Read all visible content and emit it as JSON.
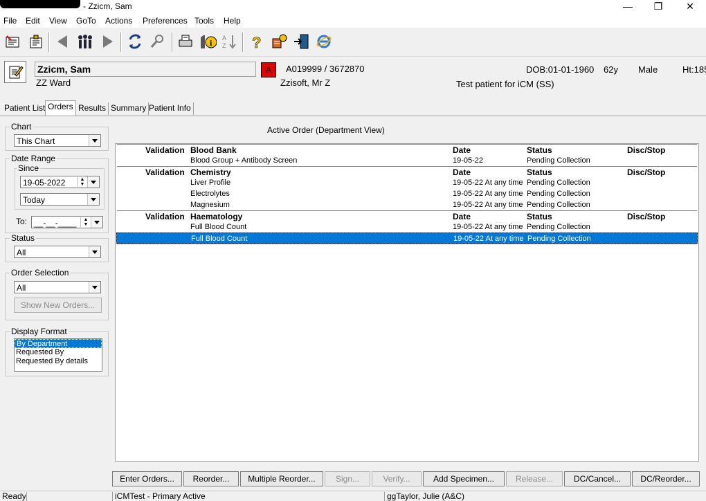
{
  "window": {
    "title": "- Zzicm, Sam",
    "minimize": "—",
    "restore": "❐",
    "close": "✕"
  },
  "menu": [
    "File",
    "Edit",
    "View",
    "GoTo",
    "Actions",
    "Preferences",
    "Tools",
    "Help"
  ],
  "toolbar_icons": [
    "patient-list-icon",
    "patient-chart-icon",
    "back-arrow-icon",
    "patients-icon",
    "forward-arrow-icon",
    "refresh-icon",
    "search-icon",
    "print-icon",
    "info-icon",
    "sort-icon",
    "help-icon",
    "settings-icon",
    "exit-icon",
    "internet-explorer-icon"
  ],
  "patient": {
    "name": "Zzicm, Sam",
    "ward": "ZZ Ward",
    "alert": "A",
    "ids": "A019999 / 3672870",
    "consultant": "Zzisoft, Mr Z",
    "dob": "DOB:01-01-1960",
    "age": "62y",
    "sex": "Male",
    "height": "Ht:185",
    "note": "Test patient for iCM (SS)"
  },
  "tabs": [
    "Patient List",
    "Orders",
    "Results",
    "Summary",
    "Patient Info"
  ],
  "active_tab": "Orders",
  "filters": {
    "chart_label": "Chart",
    "chart_value": "This Chart",
    "date_range_label": "Date Range",
    "since_label": "Since",
    "since_date": "19-05-2022",
    "since_preset": "Today",
    "to_label": "To:",
    "to_value": "__-__-____",
    "status_label": "Status",
    "status_value": "All",
    "order_selection_label": "Order Selection",
    "order_selection_value": "All",
    "show_new_orders": "Show New Orders...",
    "display_format_label": "Display Format",
    "display_formats": [
      "By Department",
      "Requested By",
      "Requested By details"
    ],
    "selected_format": "By Department"
  },
  "view_title": "Active Order (Department View)",
  "columns": {
    "validation": "Validation",
    "date": "Date",
    "status": "Status",
    "disc": "Disc/Stop"
  },
  "sections": [
    {
      "department": "Blood Bank",
      "orders": [
        {
          "name": "Blood Group + Antibody Screen",
          "date": "19-05-22",
          "status": "Pending Collection",
          "selected": false
        }
      ]
    },
    {
      "department": "Chemistry",
      "orders": [
        {
          "name": "Liver Profile",
          "date": "19-05-22 At any time",
          "status": "Pending Collection",
          "selected": false
        },
        {
          "name": "Electrolytes",
          "date": "19-05-22 At any time",
          "status": "Pending Collection",
          "selected": false
        },
        {
          "name": "Magnesium",
          "date": "19-05-22 At any time",
          "status": "Pending Collection",
          "selected": false
        }
      ]
    },
    {
      "department": "Haematology",
      "orders": [
        {
          "name": "Full Blood Count",
          "date": "19-05-22 At any time",
          "status": "Pending Collection",
          "selected": false
        },
        {
          "name": "Full Blood Count",
          "date": "19-05-22 At any time",
          "status": "Pending Collection",
          "selected": true
        }
      ]
    }
  ],
  "bottom_buttons": [
    {
      "label": "Enter Orders...",
      "enabled": true
    },
    {
      "label": "Reorder...",
      "enabled": true
    },
    {
      "label": "Multiple Reorder...",
      "enabled": true
    },
    {
      "label": "Sign...",
      "enabled": false
    },
    {
      "label": "Verify...",
      "enabled": false
    },
    {
      "label": "Add Specimen...",
      "enabled": true
    },
    {
      "label": "Release...",
      "enabled": false
    },
    {
      "label": "DC/Cancel...",
      "enabled": true
    },
    {
      "label": "DC/Reorder...",
      "enabled": true
    }
  ],
  "statusbar": {
    "state": "Ready",
    "session": "iCMTest - Primary Active",
    "user": "ggTaylor, Julie  (A&C)"
  }
}
